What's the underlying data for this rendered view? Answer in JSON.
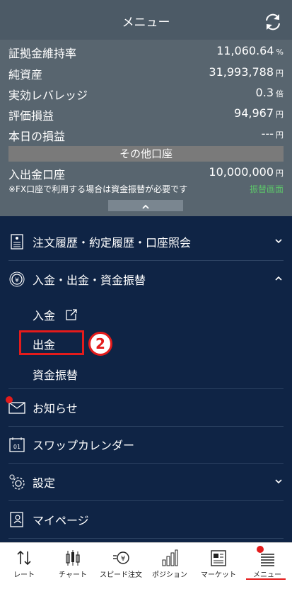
{
  "header": {
    "title": "メニュー",
    "refresh_icon": "refresh-icon"
  },
  "account": {
    "rows": [
      {
        "label": "証拠金維持率",
        "value": "11,060.64",
        "unit": "%"
      },
      {
        "label": "純資産",
        "value": "31,993,788",
        "unit": "円"
      },
      {
        "label": "実効レバレッジ",
        "value": "0.3",
        "unit": "倍"
      },
      {
        "label": "評価損益",
        "value": "94,967",
        "unit": "円"
      },
      {
        "label": "本日の損益",
        "value": "---",
        "unit": "円"
      }
    ],
    "other_account_title": "その他口座",
    "deposit_account": {
      "label": "入出金口座",
      "value": "10,000,000",
      "unit": "円"
    },
    "note": "※FX口座で利用する場合は資金振替が必要です",
    "transfer_link": "振替画面"
  },
  "menu": {
    "items": [
      {
        "label": "注文履歴・約定履歴・口座照会",
        "icon": "document-icon"
      },
      {
        "label": "入金・出金・資金振替",
        "icon": "coin-stack-icon"
      },
      {
        "label": "お知らせ",
        "icon": "envelope-icon"
      },
      {
        "label": "スワップカレンダー",
        "icon": "calendar-icon"
      },
      {
        "label": "設定",
        "icon": "gear-icon"
      },
      {
        "label": "マイページ",
        "icon": "user-document-icon"
      }
    ],
    "subitems": [
      "入金",
      "出金",
      "資金振替"
    ],
    "callout_number": "2"
  },
  "tabbar": {
    "tabs": [
      {
        "label": "レート",
        "icon": "rate-arrows-icon"
      },
      {
        "label": "チャート",
        "icon": "candlestick-icon"
      },
      {
        "label": "スピード注文",
        "icon": "speed-order-icon"
      },
      {
        "label": "ポジション",
        "icon": "bar-chart-icon"
      },
      {
        "label": "マーケット",
        "icon": "newspaper-icon"
      },
      {
        "label": "メニュー",
        "icon": "menu-list-icon"
      }
    ],
    "active": "メニュー"
  },
  "colors": {
    "header_bg": "#4c5a66",
    "account_bg": "#58656f",
    "menu_bg": "#0f2445",
    "accent_red": "#e41b1b",
    "link_green": "#5cc36a"
  }
}
